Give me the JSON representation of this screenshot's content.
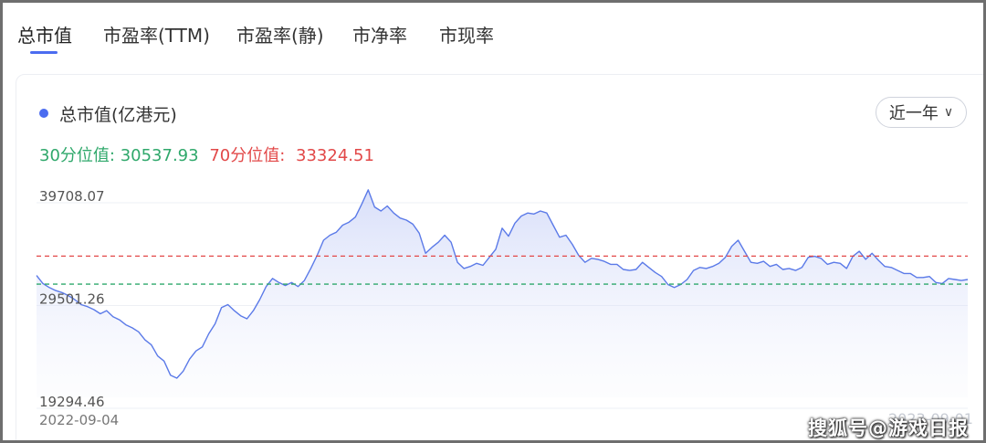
{
  "tabs": [
    {
      "label": "总市值"
    },
    {
      "label": "市盈率(TTM)"
    },
    {
      "label": "市盈率(静)"
    },
    {
      "label": "市净率"
    },
    {
      "label": "市现率"
    }
  ],
  "legend": {
    "label": "总市值(亿港元)",
    "color": "#4b6cf0"
  },
  "range_select": {
    "value": "近一年"
  },
  "percentiles": {
    "p30_label": "30分位值:",
    "p30_value": "30537.93",
    "p70_label": "70分位值:",
    "p70_value": "33324.51"
  },
  "ghost_date": "2023-09-01",
  "watermark": "搜狐号@游戏日报",
  "chart_data": {
    "type": "area",
    "series": [
      {
        "name": "总市值(亿港元)",
        "color": "#5b7ae8"
      }
    ],
    "y_tick_labels": [
      "39708.07",
      "29501.26",
      "19294.46"
    ],
    "ylim": [
      19294.46,
      39708.07
    ],
    "x_tick_labels": [
      "2022-09-04"
    ],
    "reference_lines": [
      {
        "label": "70分位值",
        "value": 33324.51,
        "color": "#e24848",
        "style": "dashed"
      },
      {
        "label": "30分位值",
        "value": 30537.93,
        "color": "#2fa86b",
        "style": "dashed"
      }
    ],
    "values": [
      31400,
      30600,
      30200,
      29900,
      29700,
      29400,
      29000,
      28500,
      28300,
      28000,
      27600,
      27900,
      27300,
      27000,
      26500,
      26200,
      25800,
      25000,
      24500,
      23400,
      22900,
      21500,
      21200,
      21900,
      23100,
      23900,
      24300,
      25600,
      26600,
      28200,
      28500,
      27900,
      27400,
      27100,
      27900,
      29000,
      30300,
      31100,
      30700,
      30400,
      30700,
      30300,
      30900,
      32100,
      33400,
      34900,
      35400,
      35700,
      36400,
      36700,
      37200,
      38500,
      39900,
      38200,
      37800,
      38300,
      37600,
      37100,
      36900,
      36500,
      35600,
      33600,
      34200,
      34700,
      35400,
      34700,
      32700,
      32100,
      32300,
      32600,
      32400,
      33200,
      34000,
      36100,
      35300,
      36600,
      37300,
      37600,
      37500,
      37800,
      37600,
      36400,
      35200,
      35400,
      34500,
      33400,
      32700,
      33100,
      33000,
      32800,
      32500,
      32500,
      32000,
      31900,
      32000,
      32700,
      32200,
      31700,
      31300,
      30500,
      30200,
      30500,
      31000,
      31900,
      32200,
      32100,
      32300,
      32600,
      33200,
      34300,
      34900,
      33800,
      32700,
      32600,
      32800,
      32300,
      32500,
      32000,
      32100,
      31900,
      32200,
      33200,
      33300,
      33100,
      32500,
      32700,
      32600,
      32100,
      33300,
      33800,
      33000,
      33600,
      32900,
      32300,
      32200,
      31900,
      31600,
      31600,
      31200,
      31200,
      31300,
      30700,
      30600,
      31100,
      31000,
      30900,
      31000
    ]
  }
}
